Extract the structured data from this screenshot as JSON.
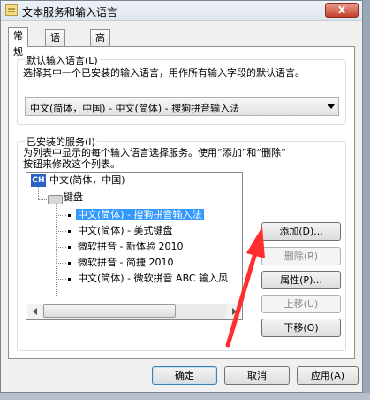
{
  "window": {
    "title": "文本服务和输入语言",
    "close_label": "X"
  },
  "tabs": [
    {
      "label": "常规",
      "active": true
    },
    {
      "label": "语言栏",
      "active": false
    },
    {
      "label": "高级键设置",
      "active": false
    }
  ],
  "default_language": {
    "group_title": "默认输入语言(L)",
    "description": "选择其中一个已安装的输入语言，用作所有输入字段的默认语言。",
    "selected": "中文(简体，中国) - 中文(简体) - 搜狗拼音输入法"
  },
  "installed_services": {
    "group_title": "已安装的服务(I)",
    "description_line1": "为列表中显示的每个输入语言选择服务。使用“添加”和“删除”",
    "description_line2": "按钮来修改这个列表。",
    "language_badge": "CH",
    "language_label": "中文(简体，中国)",
    "category_label": "键盘",
    "items": [
      {
        "label": "中文(简体) - 搜狗拼音输入法",
        "selected": true
      },
      {
        "label": "中文(简体) - 美式键盘",
        "selected": false
      },
      {
        "label": "微软拼音 - 新体验 2010",
        "selected": false
      },
      {
        "label": "微软拼音 - 简捷 2010",
        "selected": false
      },
      {
        "label": "中文(简体) - 微软拼音 ABC 输入风",
        "selected": false
      }
    ]
  },
  "side_buttons": {
    "add": "添加(D)...",
    "remove": "删除(R)",
    "properties": "属性(P)...",
    "move_up": "上移(U)",
    "move_down": "下移(O)"
  },
  "footer": {
    "ok": "确定",
    "cancel": "取消",
    "apply": "应用(A)"
  },
  "colors": {
    "selection": "#3399ff",
    "annotation_arrow": "#ff2d2d"
  }
}
